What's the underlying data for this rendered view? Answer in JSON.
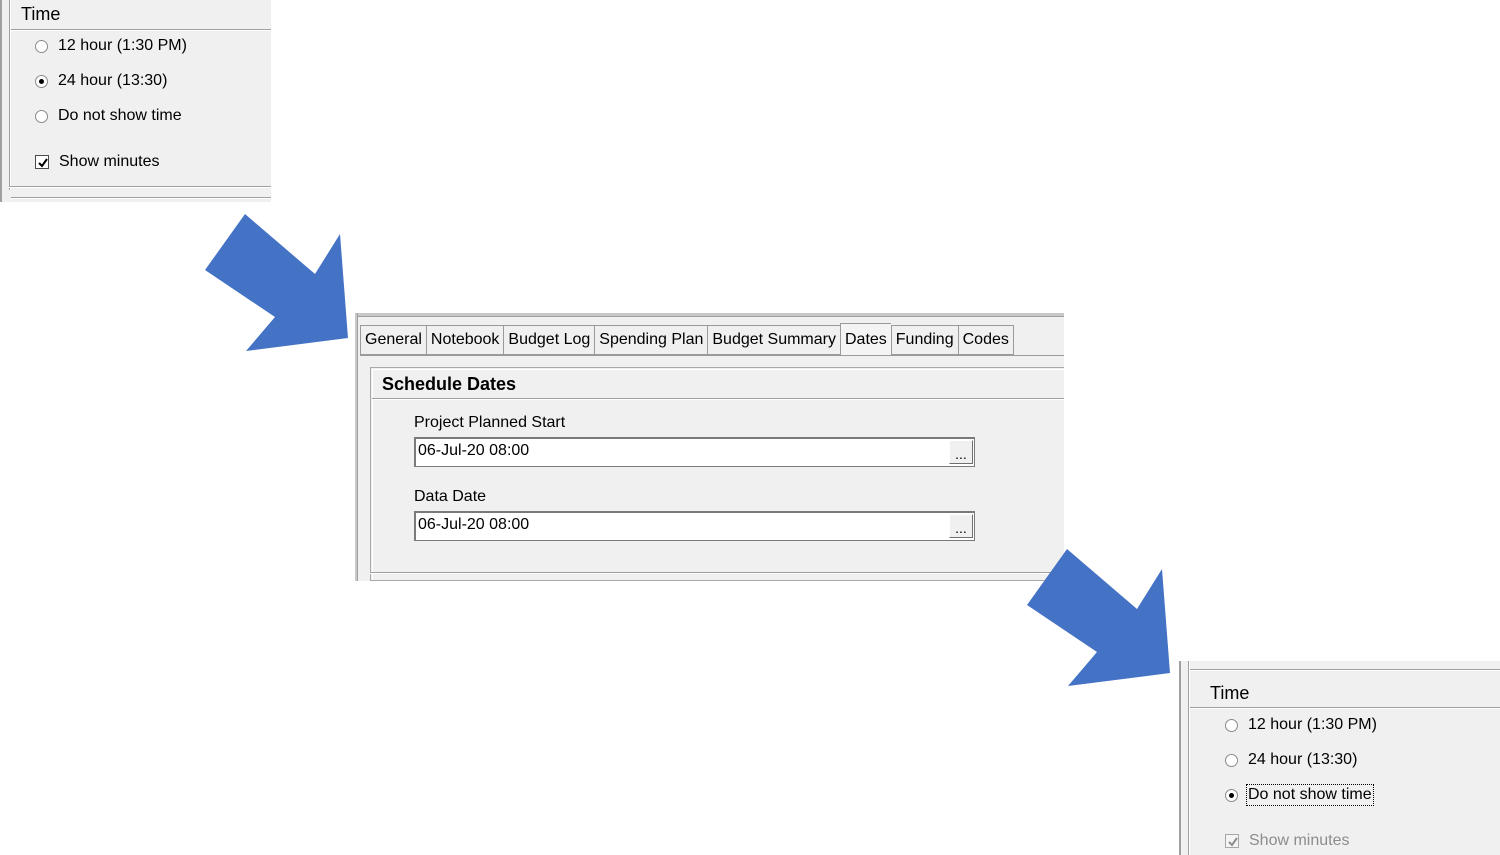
{
  "time_panel_before": {
    "title": "Time",
    "options": [
      {
        "label": "12 hour (1:30 PM)",
        "checked": false
      },
      {
        "label": "24 hour (13:30)",
        "checked": true
      },
      {
        "label": "Do not show time",
        "checked": false
      }
    ],
    "show_minutes": {
      "label": "Show minutes",
      "checked": true,
      "enabled": true
    }
  },
  "dates_panel": {
    "tabs": [
      "General",
      "Notebook",
      "Budget Log",
      "Spending Plan",
      "Budget Summary",
      "Dates",
      "Funding",
      "Codes"
    ],
    "active_tab": "Dates",
    "group_title": "Schedule Dates",
    "fields": [
      {
        "label": "Project Planned Start",
        "value": "06-Jul-20 08:00",
        "button": "..."
      },
      {
        "label": "Data Date",
        "value": "06-Jul-20 08:00",
        "button": "..."
      }
    ]
  },
  "time_panel_after": {
    "title": "Time",
    "options": [
      {
        "label": "12 hour (1:30 PM)",
        "checked": false
      },
      {
        "label": "24 hour (13:30)",
        "checked": false
      },
      {
        "label": "Do not show time",
        "checked": true
      }
    ],
    "show_minutes": {
      "label": "Show minutes",
      "checked": true,
      "enabled": false
    }
  },
  "colors": {
    "arrow": "#4472c4",
    "panel_bg": "#f0f0f0",
    "disabled_text": "#8d8d8d"
  }
}
